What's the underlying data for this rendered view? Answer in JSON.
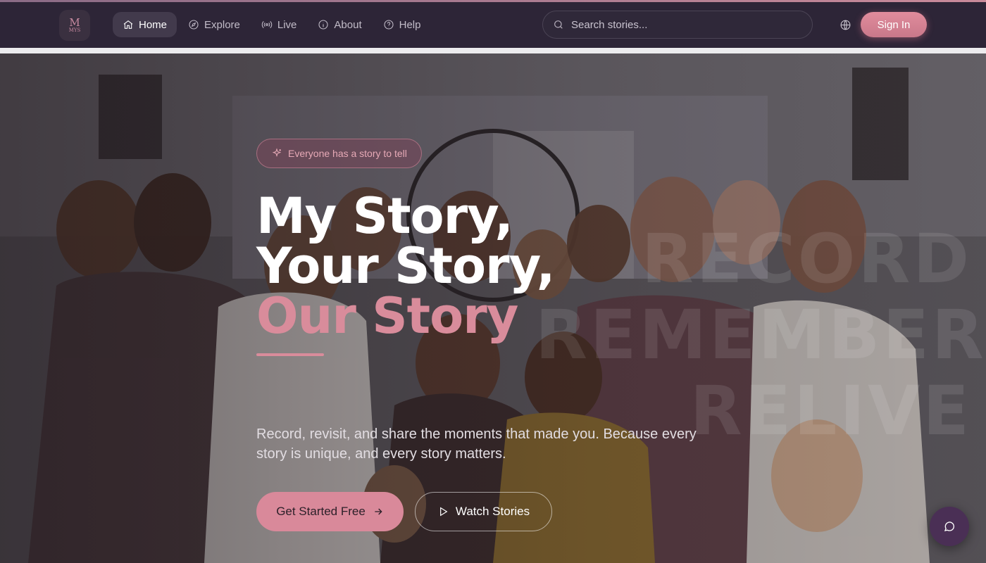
{
  "brand": {
    "logo_monogram": "M",
    "logo_text": "MYS"
  },
  "nav": {
    "items": [
      {
        "label": "Home",
        "icon": "home-icon",
        "active": true
      },
      {
        "label": "Explore",
        "icon": "compass-icon",
        "active": false
      },
      {
        "label": "Live",
        "icon": "broadcast-icon",
        "active": false
      },
      {
        "label": "About",
        "icon": "info-icon",
        "active": false
      },
      {
        "label": "Help",
        "icon": "help-circle-icon",
        "active": false
      }
    ],
    "search_placeholder": "Search stories...",
    "language_icon": "globe-icon",
    "signin_label": "Sign In"
  },
  "hero": {
    "badge": "Everyone has a story to tell",
    "headline_line1": "My Story,",
    "headline_line2": "Your Story,",
    "headline_line3": "Our Story",
    "ghost_words": [
      "RECORD",
      "REMEMBER",
      "RELIVE"
    ],
    "lead": "Record, revisit, and share the moments that made you. Because every story is unique, and every story matters.",
    "cta_primary": "Get Started Free",
    "cta_secondary": "Watch Stories"
  },
  "colors": {
    "accent": "#d98c9b",
    "nav_bg": "#2d2537",
    "chat_bg": "#4a2f55"
  }
}
